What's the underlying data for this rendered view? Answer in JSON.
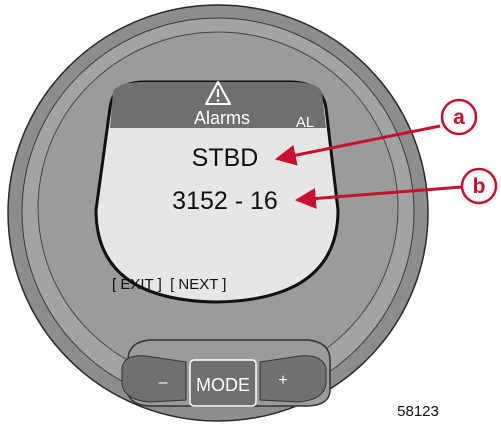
{
  "screen": {
    "header_title": "Alarms",
    "header_tag": "AL",
    "warning_icon": "warning-triangle-icon",
    "line1": "STBD",
    "line2": "3152 - 16",
    "softkeys": "[ EXIT ]  [ NEXT ]"
  },
  "buttons": {
    "minus": "–",
    "mode": "MODE",
    "plus": "+"
  },
  "callouts": [
    {
      "letter": "a"
    },
    {
      "letter": "b"
    }
  ],
  "figure_number": "58123",
  "colors": {
    "bezel": "#9e9e9e",
    "screen": "#e6e6e6",
    "header": "#6f6f6f",
    "arrow": "#c8102e"
  }
}
